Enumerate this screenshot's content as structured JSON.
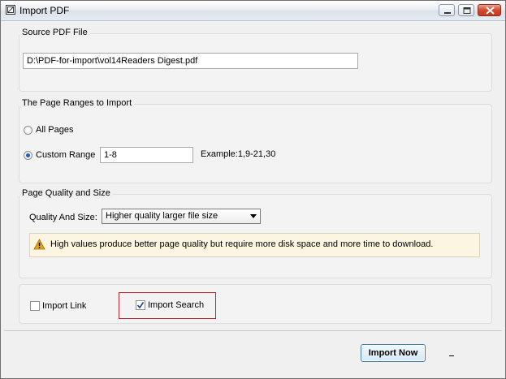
{
  "window": {
    "title": "Import PDF",
    "icon": "window-app-icon",
    "controls": [
      "minimize-icon",
      "maximize-icon",
      "close-icon"
    ]
  },
  "source": {
    "group_title": "Source PDF File",
    "path_value": "D:\\PDF-for-import\\vol14Readers Digest.pdf"
  },
  "page_ranges": {
    "group_title": "The Page Ranges to Import",
    "all_pages_label": "All Pages",
    "all_pages_selected": false,
    "custom_range_label": "Custom Range",
    "custom_range_selected": true,
    "custom_range_value": "1-8",
    "example_text": "Example:1,9-21,30"
  },
  "quality": {
    "group_title": "Page Quality and Size",
    "label": "Quality And Size:",
    "selected_option": "Higher quality larger file size",
    "warning_icon": "warning-icon",
    "warning_text": "High values produce better page quality but require more disk space and more time to download."
  },
  "options": {
    "import_link_label": "Import Link",
    "import_link_checked": false,
    "import_search_label": "Import Search",
    "import_search_checked": true
  },
  "footer": {
    "import_button_label": "Import Now"
  },
  "colors": {
    "highlight_border": "#c0262c",
    "radio_dot": "#1f5fb8",
    "warning_background": "#fcf5e1",
    "warning_icon": "#e8a317",
    "close_button": "#c94a33"
  }
}
